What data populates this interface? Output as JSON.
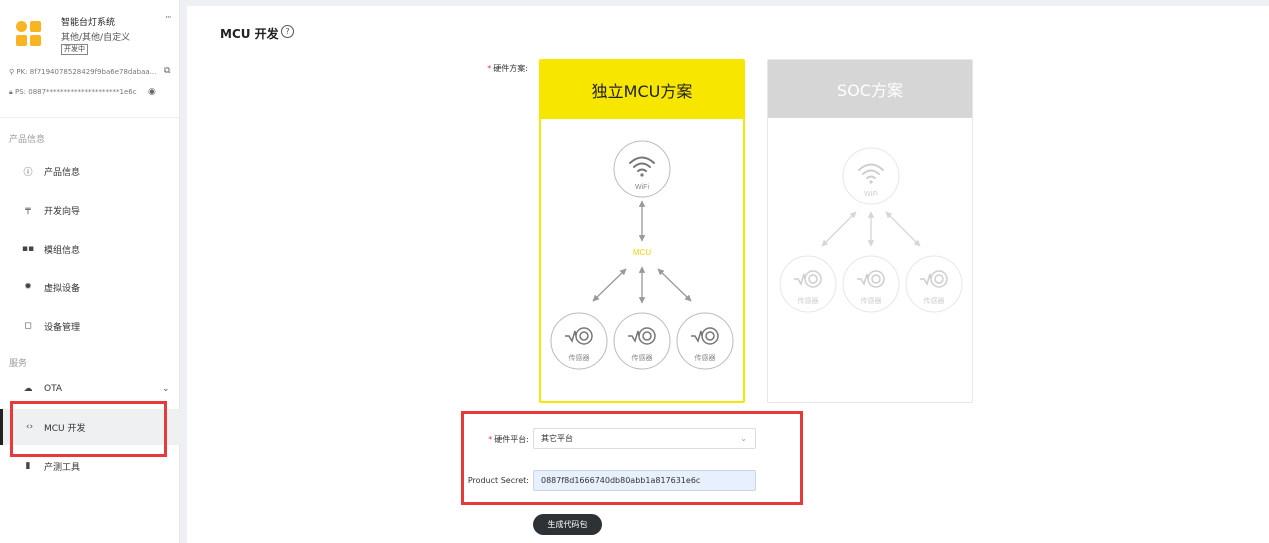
{
  "product": {
    "name": "智能台灯系统",
    "category": "其他/其他/自定义",
    "status": "开发中",
    "more": "···",
    "pk_label": "PK:",
    "pk_value": "8f7194078528429f9ba6e78dabaa...",
    "ps_label": "PS:",
    "ps_value": "0887*********************1e6c"
  },
  "sidebar": {
    "group_product": "产品信息",
    "group_service": "服务",
    "items": [
      {
        "label": "产品信息",
        "icon": "info-icon"
      },
      {
        "label": "开发向导",
        "icon": "pin-icon"
      },
      {
        "label": "模组信息",
        "icon": "grid-icon"
      },
      {
        "label": "虚拟设备",
        "icon": "gear-icon"
      },
      {
        "label": "设备管理",
        "icon": "clipboard-icon"
      },
      {
        "label": "OTA",
        "icon": "cloud-upload-icon"
      },
      {
        "label": "MCU 开发",
        "icon": "code-icon"
      },
      {
        "label": "产测工具",
        "icon": "tool-icon"
      }
    ]
  },
  "main": {
    "title": "MCU 开发",
    "hardware_scheme_label": "硬件方案:",
    "cards": [
      {
        "title": "独立MCU方案",
        "selected": true,
        "hub_label": "MCU",
        "wifi_label": "WiFi",
        "sensor_label": "传感器"
      },
      {
        "title": "SOC方案",
        "selected": false,
        "wifi_label": "WiFi",
        "sensor_label": "传感器"
      }
    ],
    "platform_label": "硬件平台:",
    "platform_value": "其它平台",
    "secret_label": "Product Secret:",
    "secret_value": "0887f8d1666740db80abb1a817631e6c",
    "generate_button": "生成代码包"
  },
  "colors": {
    "accent_yellow": "#f7e600",
    "highlight_red": "#e8393b",
    "button_dark": "#2d3236"
  }
}
